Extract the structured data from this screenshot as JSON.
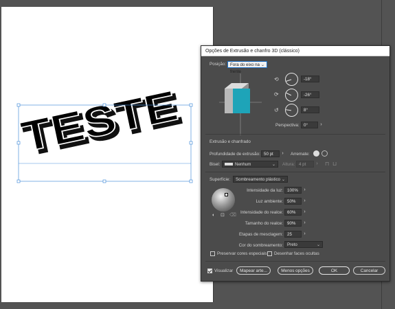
{
  "artboard": {
    "text": "TESTE"
  },
  "dialog": {
    "title": "Opções de Extrusão e chanfro 3D (clássico)",
    "position_label": "Posição:",
    "position_value": "Fora do eixo na frente",
    "rotation": {
      "x": "-18°",
      "y": "-26°",
      "z": "8°"
    },
    "perspective_label": "Perspectiva:",
    "perspective_value": "0°",
    "extrude_section": "Extrusão e chanfrado",
    "depth_label": "Profundidade de extrusão:",
    "depth_value": "50 pt",
    "cap_label": "Arremate:",
    "bevel_label": "Bisel:",
    "bevel_value": "Nenhum",
    "height_label": "Altura:",
    "height_value": "4 pt",
    "surface_label": "Superfície:",
    "surface_value": "Sombreamento plástico",
    "light_intensity_label": "Intensidade da luz:",
    "light_intensity_value": "100%",
    "ambient_label": "Luz ambiente:",
    "ambient_value": "50%",
    "highlight_intensity_label": "Intensidade do realce:",
    "highlight_intensity_value": "60%",
    "highlight_size_label": "Tamanho do realce:",
    "highlight_size_value": "90%",
    "blend_steps_label": "Etapas de mesclagem:",
    "blend_steps_value": "25",
    "shading_color_label": "Cor do sombreamento:",
    "shading_color_value": "Preto",
    "preserve_spot_label": "Preservar cores especiais",
    "draw_hidden_label": "Desenhar faces ocultas",
    "preview_label": "Visualizar",
    "map_art_label": "Mapear arte...",
    "less_options_label": "Menos opções",
    "ok_label": "OK",
    "cancel_label": "Cancelar",
    "cube_face_color": "#1ea4b8"
  }
}
